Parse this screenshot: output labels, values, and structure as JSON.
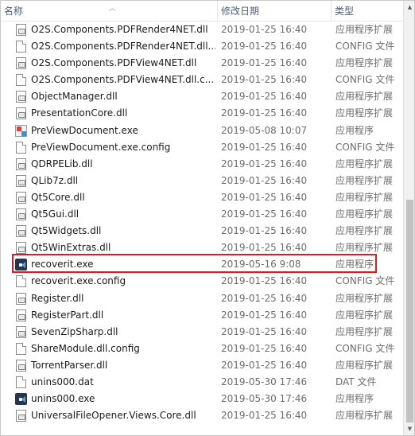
{
  "columns": {
    "name": "名称",
    "date": "修改日期",
    "type": "类型"
  },
  "files": [
    {
      "name": "O2S.Components.PDFRender4NET.dll",
      "date": "2019-01-25 16:40",
      "type": "应用程序扩展",
      "icon": "dll-file-icon"
    },
    {
      "name": "O2S.Components.PDFRender4NET.dll....",
      "date": "2019-01-25 16:40",
      "type": "CONFIG 文件",
      "icon": "config-file-icon"
    },
    {
      "name": "O2S.Components.PDFView4NET.dll",
      "date": "2019-01-25 16:40",
      "type": "应用程序扩展",
      "icon": "dll-file-icon"
    },
    {
      "name": "O2S.Components.PDFView4NET.dll.c...",
      "date": "2019-01-25 16:40",
      "type": "CONFIG 文件",
      "icon": "config-file-icon"
    },
    {
      "name": "ObjectManager.dll",
      "date": "2019-01-25 16:40",
      "type": "应用程序扩展",
      "icon": "dll-file-icon"
    },
    {
      "name": "PresentationCore.dll",
      "date": "2019-01-25 16:40",
      "type": "应用程序扩展",
      "icon": "dll-file-icon"
    },
    {
      "name": "PreViewDocument.exe",
      "date": "2019-05-08 10:07",
      "type": "应用程序",
      "icon": "preview-app-icon"
    },
    {
      "name": "PreViewDocument.exe.config",
      "date": "2019-01-25 16:40",
      "type": "CONFIG 文件",
      "icon": "config-file-icon"
    },
    {
      "name": "QDRPELib.dll",
      "date": "2019-01-25 16:40",
      "type": "应用程序扩展",
      "icon": "dll-file-icon"
    },
    {
      "name": "QLib7z.dll",
      "date": "2019-01-25 16:40",
      "type": "应用程序扩展",
      "icon": "dll-file-icon"
    },
    {
      "name": "Qt5Core.dll",
      "date": "2019-01-25 16:40",
      "type": "应用程序扩展",
      "icon": "dll-file-icon"
    },
    {
      "name": "Qt5Gui.dll",
      "date": "2019-01-25 16:40",
      "type": "应用程序扩展",
      "icon": "dll-file-icon"
    },
    {
      "name": "Qt5Widgets.dll",
      "date": "2019-01-25 16:40",
      "type": "应用程序扩展",
      "icon": "dll-file-icon"
    },
    {
      "name": "Qt5WinExtras.dll",
      "date": "2019-01-25 16:40",
      "type": "应用程序扩展",
      "icon": "dll-file-icon"
    },
    {
      "name": "recoverit.exe",
      "date": "2019-05-16 9:08",
      "type": "应用程序",
      "icon": "recoverit-app-icon",
      "highlighted": true
    },
    {
      "name": "recoverit.exe.config",
      "date": "2019-01-25 16:40",
      "type": "CONFIG 文件",
      "icon": "config-file-icon"
    },
    {
      "name": "Register.dll",
      "date": "2019-01-25 16:40",
      "type": "应用程序扩展",
      "icon": "dll-file-icon"
    },
    {
      "name": "RegisterPart.dll",
      "date": "2019-01-25 16:40",
      "type": "应用程序扩展",
      "icon": "dll-file-icon"
    },
    {
      "name": "SevenZipSharp.dll",
      "date": "2019-01-25 16:40",
      "type": "应用程序扩展",
      "icon": "dll-file-icon"
    },
    {
      "name": "ShareModule.dll.config",
      "date": "2019-01-25 16:40",
      "type": "CONFIG 文件",
      "icon": "config-file-icon"
    },
    {
      "name": "TorrentParser.dll",
      "date": "2019-01-25 16:40",
      "type": "应用程序扩展",
      "icon": "dll-file-icon"
    },
    {
      "name": "unins000.dat",
      "date": "2019-05-30 17:46",
      "type": "DAT 文件",
      "icon": "dat-file-icon"
    },
    {
      "name": "unins000.exe",
      "date": "2019-05-30 17:46",
      "type": "应用程序",
      "icon": "uninstaller-app-icon"
    },
    {
      "name": "UniversalFileOpener.Views.Core.dll",
      "date": "2019-01-25 16:40",
      "type": "应用程序扩展",
      "icon": "dll-file-icon"
    }
  ],
  "colors": {
    "highlight_border": "#e01b1b",
    "header_text": "#4c607a",
    "secondary_text": "#6d6d6d"
  }
}
